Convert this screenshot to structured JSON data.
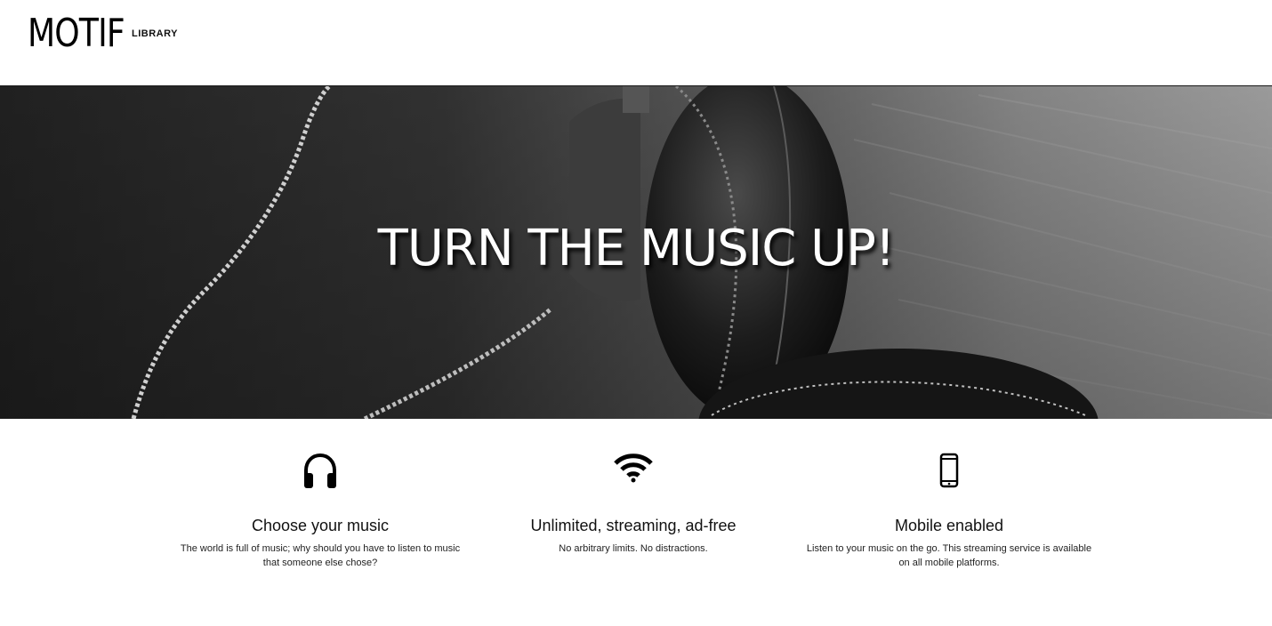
{
  "header": {
    "logo": "MOTIF",
    "nav": [
      {
        "label": "LIBRARY"
      }
    ]
  },
  "hero": {
    "title": "TURN THE MUSIC UP!",
    "image": "black-and-white headphones on wooden surface"
  },
  "features": [
    {
      "icon": "headphones-icon",
      "title": "Choose your music",
      "text": "The world is full of music; why should you have to listen to music that someone else chose?"
    },
    {
      "icon": "wifi-icon",
      "title": "Unlimited, streaming, ad-free",
      "text": "No arbitrary limits. No distractions."
    },
    {
      "icon": "mobile-phone-icon",
      "title": "Mobile enabled",
      "text": "Listen to your music on the go. This streaming service is available on all mobile platforms."
    }
  ]
}
